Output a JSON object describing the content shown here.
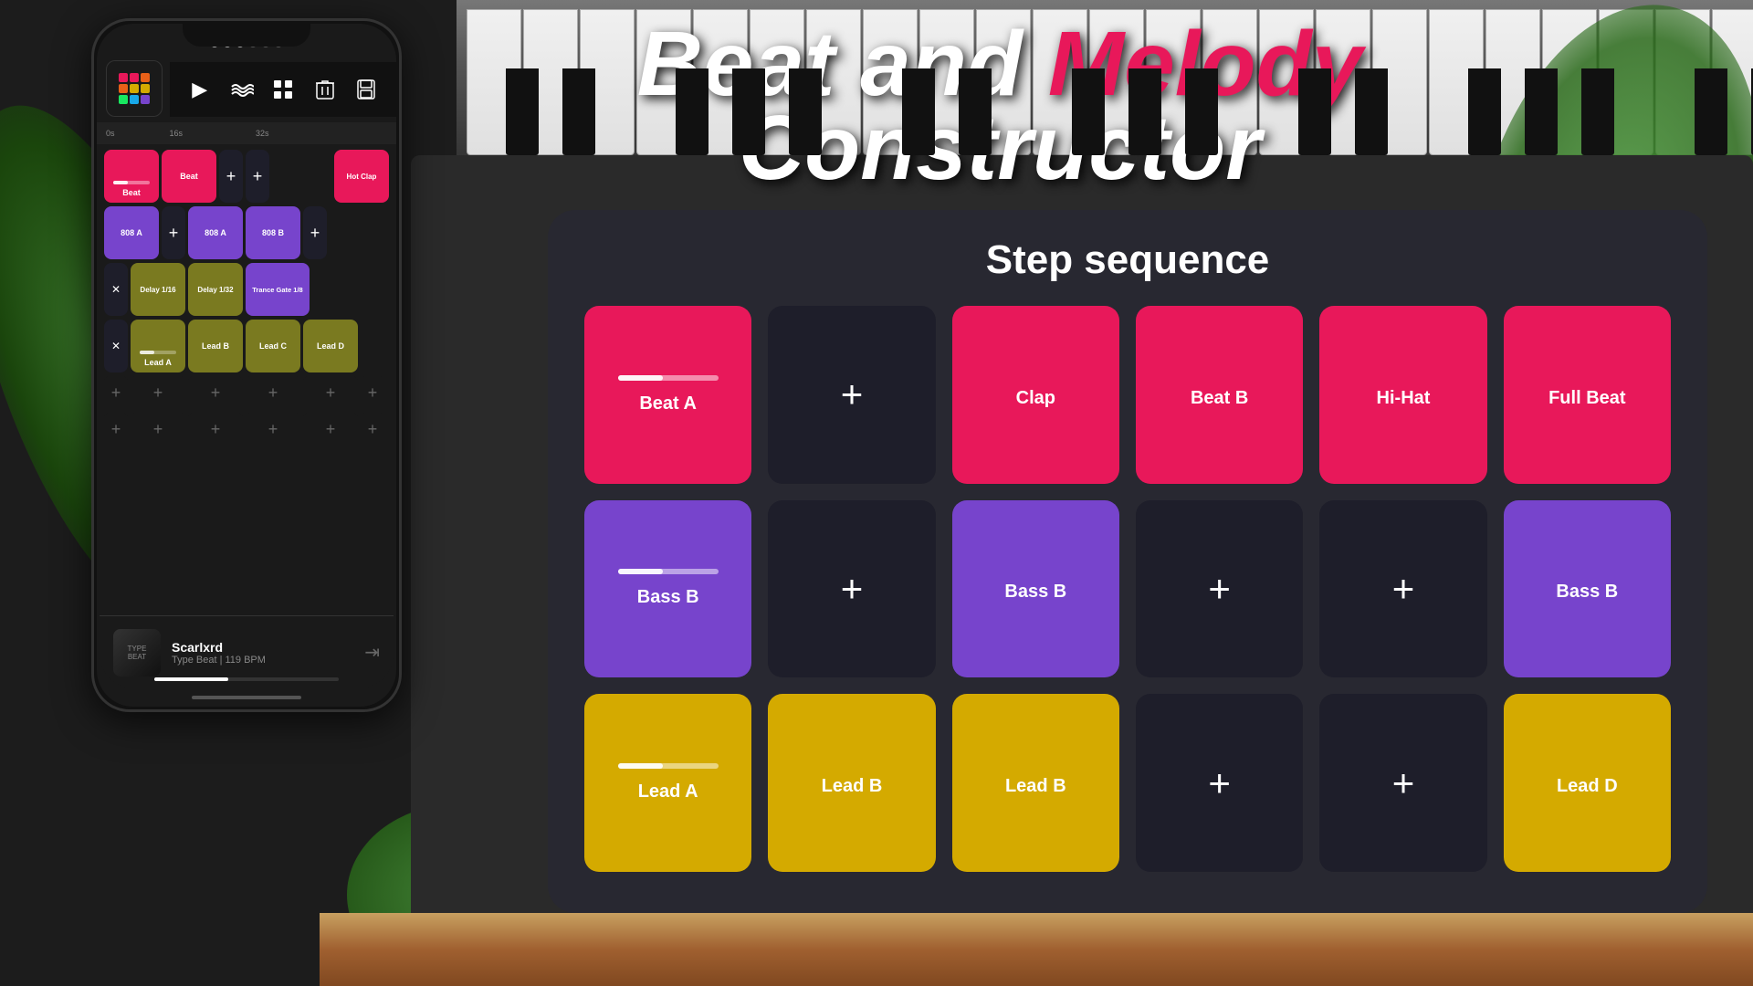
{
  "title": {
    "line1_part1": "Beat and ",
    "line1_melody": "Melody",
    "line2": "Constructor"
  },
  "step_sequence": {
    "title": "Step sequence",
    "row1": [
      {
        "label": "Beat A",
        "type": "red",
        "has_slider": true
      },
      {
        "label": "+",
        "type": "dark",
        "is_plus": true
      },
      {
        "label": "Clap",
        "type": "red"
      },
      {
        "label": "Beat B",
        "type": "red"
      },
      {
        "label": "Hi-Hat",
        "type": "red"
      },
      {
        "label": "Full Beat",
        "type": "red"
      }
    ],
    "row2": [
      {
        "label": "Bass B",
        "type": "purple",
        "has_slider": true
      },
      {
        "label": "+",
        "type": "dark",
        "is_plus": true
      },
      {
        "label": "Bass B",
        "type": "purple"
      },
      {
        "label": "+",
        "type": "dark",
        "is_plus": true
      },
      {
        "label": "+",
        "type": "dark",
        "is_plus": true
      },
      {
        "label": "Bass B",
        "type": "purple"
      }
    ],
    "row3": [
      {
        "label": "Lead A",
        "type": "yellow",
        "has_slider": true
      },
      {
        "label": "Lead B",
        "type": "yellow"
      },
      {
        "label": "Lead B",
        "type": "yellow"
      },
      {
        "label": "+",
        "type": "dark",
        "is_plus": true
      },
      {
        "label": "+",
        "type": "dark",
        "is_plus": true
      },
      {
        "label": "Lead D",
        "type": "yellow"
      }
    ]
  },
  "phone": {
    "status_dots": [
      "filled",
      "filled",
      "filled",
      "empty",
      "empty",
      "empty"
    ],
    "toolbar": {
      "play": "▶",
      "waves": "≋",
      "grid": "⊞",
      "trash": "🗑",
      "save": "💾"
    },
    "timeline": {
      "marker1": "0s",
      "marker2": "16s",
      "marker3": "32s"
    },
    "grid_rows": [
      {
        "cells": [
          {
            "label": "Beat",
            "type": "red-beat"
          },
          {
            "label": "Beat",
            "type": "red-beat"
          },
          {
            "label": "+",
            "type": "dark-btn"
          },
          {
            "label": "+",
            "type": "dark-btn"
          },
          {
            "label": "",
            "type": "spacer"
          },
          {
            "label": "Hot Clap",
            "type": "hot-clap"
          }
        ]
      },
      {
        "cells": [
          {
            "label": "808 A",
            "type": "purple-808"
          },
          {
            "label": "+",
            "type": "dark-btn"
          },
          {
            "label": "808 A",
            "type": "purple-808"
          },
          {
            "label": "808 B",
            "type": "purple-808"
          },
          {
            "label": "+",
            "type": "dark-btn"
          }
        ]
      },
      {
        "cells": [
          {
            "label": "✕",
            "type": "dark-x"
          },
          {
            "label": "",
            "type": "olive-delay",
            "text": "Delay 1/16"
          },
          {
            "label": "",
            "type": "olive-delay",
            "text": "Delay 1/32"
          },
          {
            "label": "",
            "type": "purple-trance",
            "text": "Trance Gate 1/8"
          }
        ]
      },
      {
        "cells": [
          {
            "label": "✕",
            "type": "dark-x"
          },
          {
            "label": "Lead A",
            "type": "olive-lead",
            "has_slider": true
          },
          {
            "label": "Lead B",
            "type": "olive-lead"
          },
          {
            "label": "Lead C",
            "type": "olive-lead"
          },
          {
            "label": "Lead D",
            "type": "olive-lead"
          }
        ]
      }
    ],
    "logo": {
      "dots": [
        {
          "color": "#e8185a"
        },
        {
          "color": "#e8185a"
        },
        {
          "color": "#e86018"
        },
        {
          "color": "#e86018"
        },
        {
          "color": "#e8d018"
        },
        {
          "color": "#e8d018"
        },
        {
          "color": "#18e860"
        },
        {
          "color": "#18a8e8"
        },
        {
          "color": "#7744cc"
        }
      ]
    },
    "player": {
      "name": "Scarlxrd",
      "type": "Type Beat | 119 BPM"
    }
  },
  "colors": {
    "red": "#e8185a",
    "purple": "#7744cc",
    "yellow": "#d4aa00",
    "dark": "#1e1e2a",
    "olive": "#7a7a20",
    "melody_pink": "#e8185a"
  }
}
